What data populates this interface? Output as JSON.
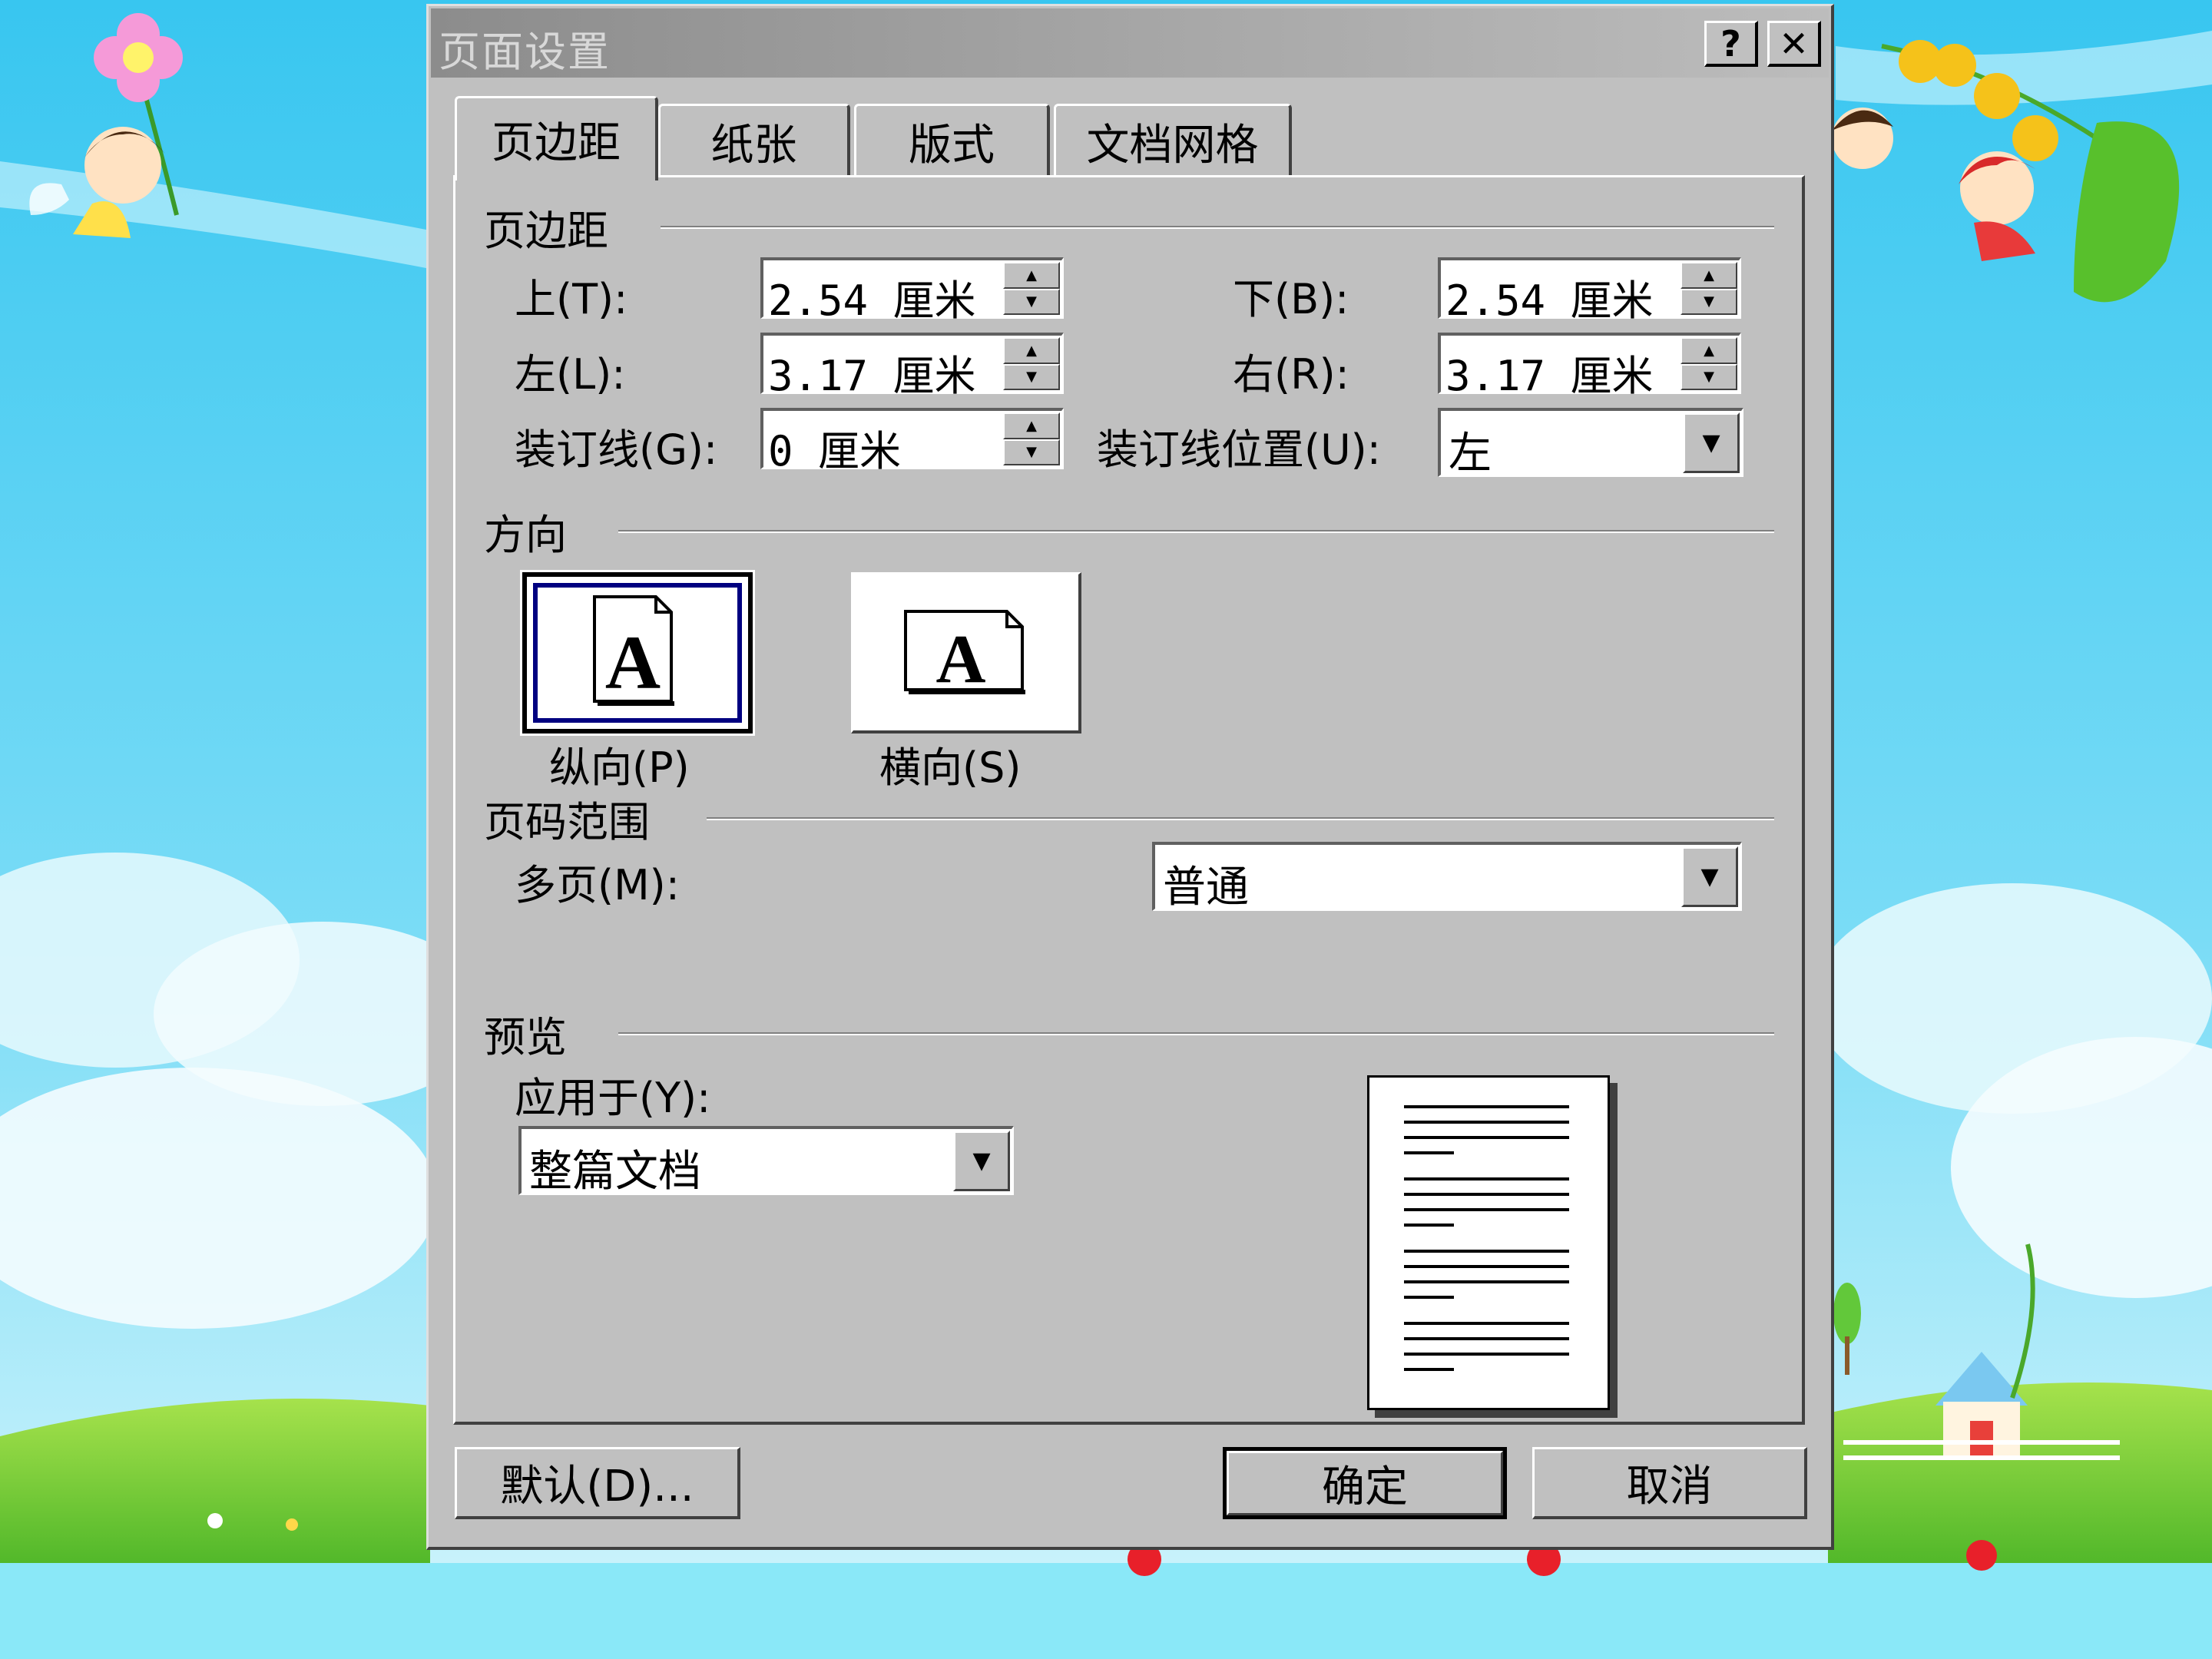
{
  "dialog": {
    "title": "页面设置",
    "help_label": "?",
    "close_label": "✕"
  },
  "tabs": [
    {
      "label": "页边距",
      "active": true
    },
    {
      "label": "纸张",
      "active": false
    },
    {
      "label": "版式",
      "active": false
    },
    {
      "label": "文档网格",
      "active": false
    }
  ],
  "margins": {
    "section_title": "页边距",
    "top_label": "上(T):",
    "top_value": "2.54 厘米",
    "bottom_label": "下(B):",
    "bottom_value": "2.54 厘米",
    "left_label": "左(L):",
    "left_value": "3.17 厘米",
    "right_label": "右(R):",
    "right_value": "3.17 厘米",
    "gutter_label": "装订线(G):",
    "gutter_value": "0 厘米",
    "gutter_pos_label": "装订线位置(U):",
    "gutter_pos_value": "左"
  },
  "orientation": {
    "section_title": "方向",
    "portrait_label": "纵向(P)",
    "landscape_label": "横向(S)",
    "icon_letter": "A",
    "selected": "portrait"
  },
  "pages": {
    "section_title": "页码范围",
    "multiple_label": "多页(M):",
    "multiple_value": "普通"
  },
  "preview": {
    "section_title": "预览",
    "apply_label": "应用于(Y):",
    "apply_value": "整篇文档"
  },
  "buttons": {
    "default_label": "默认(D)...",
    "ok_label": "确定",
    "cancel_label": "取消"
  },
  "colors": {
    "dialog_face": "#c0c0c0",
    "title_bar": "#8c8c8c",
    "sky": "#5fd0f0",
    "grass": "#7ed43a",
    "bottom_strip": "#8ae8f8",
    "selection_frame": "#000080"
  }
}
